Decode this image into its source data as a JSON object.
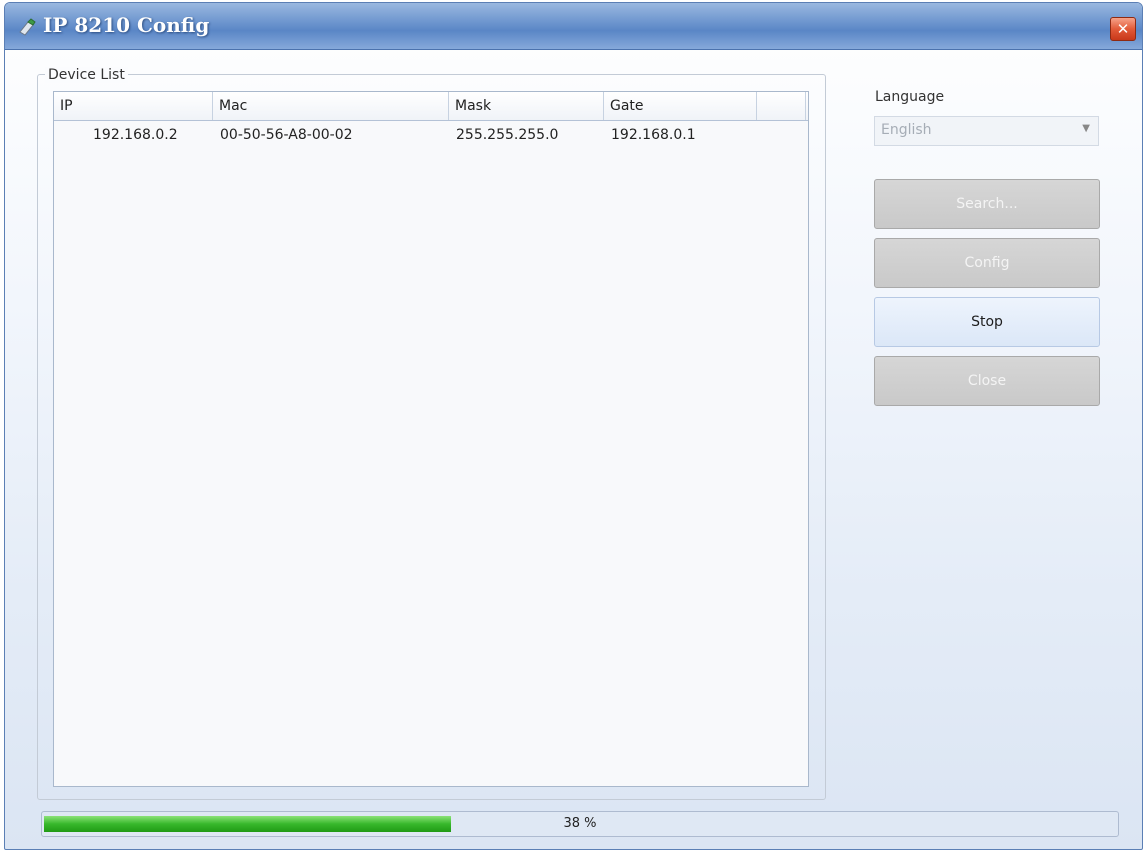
{
  "window": {
    "title": "IP 8210 Config",
    "close_symbol": "✕",
    "icon": "app-icon"
  },
  "device_list": {
    "group_label": "Device List",
    "columns": [
      "IP",
      "Mac",
      "Mask",
      "Gate",
      ""
    ],
    "rows": [
      {
        "ip": "192.168.0.2",
        "mac": "00-50-56-A8-00-02",
        "mask": "255.255.255.0",
        "gate": "192.168.0.1"
      }
    ]
  },
  "language": {
    "label": "Language",
    "selected": "English"
  },
  "buttons": {
    "search": "Search...",
    "config": "Config",
    "stop": "Stop",
    "close": "Close"
  },
  "progress": {
    "value": 38,
    "label": "38 %"
  },
  "colors": {
    "progress_fill": "#37b82b",
    "titlebar": "#5a86c6"
  }
}
